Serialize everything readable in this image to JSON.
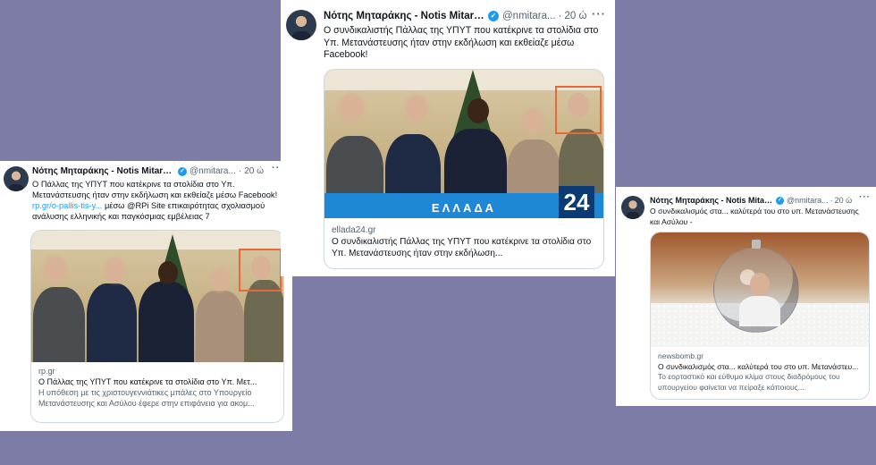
{
  "tweets": [
    {
      "id": "left",
      "author_name": "Νότης Μηταράκης - Notis Mitara...",
      "handle": "@nmitara...",
      "time": "20 ώ",
      "text_plain": "Ο Πάλλας της ΥΠΥΤ που κατέκρινε τα στολίδια στο Υπ. Μετανάστευσης ήταν στην εκδήλωση και εκθείαζε μέσω Facebook! ",
      "text_link": "rp.gr/o-pallis-tis-y...",
      "text_after": " μέσω @RPi Site επικαιρότητας σχολιασμού ανάλυσης ελληνικής και παγκόσμιας εμβέλειας 7",
      "card": {
        "domain": "rp.gr",
        "title": "Ο Πάλλας της ΥΠΥΤ που κατέκρινε τα στολίδια στο Υπ. Μετ...",
        "description": "Η υπόθεση με τις χριστουγεννιάτικες μπάλες στο Υπουργείο Μετανάστευσης και Ασύλου έφερε στην επιφάνεια για ακομ..."
      }
    },
    {
      "id": "middle",
      "author_name": "Νότης Μηταράκης - Notis Mitara...",
      "handle": "@nmitara...",
      "time": "20 ώ",
      "text_plain": "Ο συνδικαλιστής Πάλλας της ΥΠΥΤ που κατέκρινε τα στολίδια στο Υπ. Μετανάστευσης ήταν στην εκδήλωση και εκθείαζε μέσω Facebook!",
      "card": {
        "domain": "ellada24.gr",
        "title": "Ο συνδικαλιστής Πάλλας της ΥΠΥΤ που κατέκρινε τα στολίδια στο Υπ. Μετανάστευσης ήταν στην εκδήλωση...",
        "banner_text": "ΕΛΛΑΔΑ",
        "banner_logo": "24"
      }
    },
    {
      "id": "right",
      "author_name": "Νότης Μηταράκης - Notis Mitara...",
      "handle": "@nmitara...",
      "time": "20 ώ",
      "text_plain": "Ο συνδικαλισμός στα... καλύτερά του στο υπ. Μετανάστευσης και Ασύλου -",
      "card": {
        "domain": "newsbomb.gr",
        "title": "Ο συνδικαλισμός στα... καλύτερά του στο υπ. Μετανάστευ...",
        "description": "Το εορταστικό και εύθυμο κλίμα στους διαδρόμους του υπουργείου φαίνεται να πείραξε κάποιους..."
      }
    }
  ],
  "icons": {
    "verified": "verified-badge-icon",
    "more": "more-options-icon"
  },
  "colors": {
    "background": "#7c7ca6",
    "accent": "#1d9bf0",
    "highlight_box": "#e8683a"
  }
}
